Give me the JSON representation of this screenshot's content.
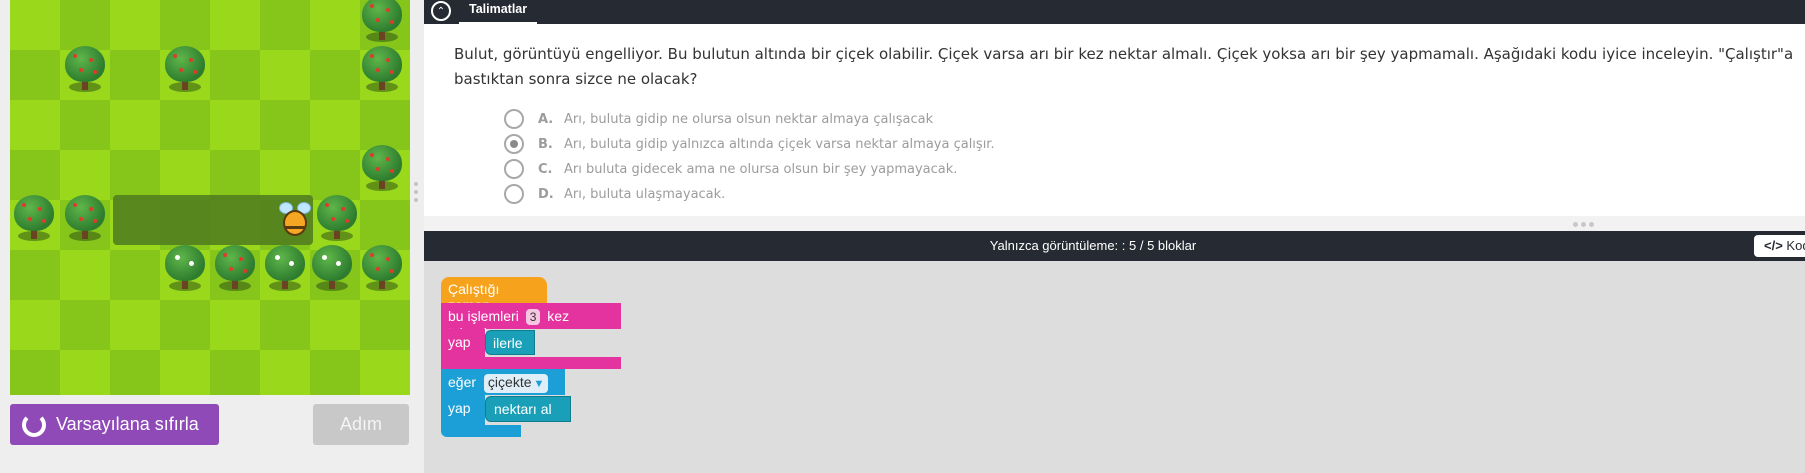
{
  "left": {
    "reset_label": "Varsayılana sıfırla",
    "step_label": "Adım"
  },
  "instructions": {
    "tab_label": "Talimatlar",
    "question": "Bulut, görüntüyü engelliyor. Bu bulutun altında bir çiçek olabilir. Çiçek varsa arı bir kez nektar almalı. Çiçek yoksa arı bir şey yapmamalı. Aşağıdaki kodu iyice inceleyin. \"Çalıştır\"a bastıktan sonra sizce ne olacak?",
    "options": [
      {
        "letter": "A.",
        "text": "Arı, buluta gidip ne olursa olsun nektar almaya çalışacak",
        "selected": false
      },
      {
        "letter": "B.",
        "text": "Arı, buluta gidip yalnızca altında çiçek varsa nektar almaya çalışır.",
        "selected": true
      },
      {
        "letter": "C.",
        "text": "Arı buluta gidecek ama ne olursa olsun bir şey yapmayacak.",
        "selected": false
      },
      {
        "letter": "D.",
        "text": "Arı, buluta ulaşmayacak.",
        "selected": false
      }
    ]
  },
  "workspace": {
    "title": "Yalnızca görüntüleme: : 5 / 5 bloklar",
    "code_button": "Kod",
    "blocks": {
      "when_run": "Çalıştığı zaman",
      "repeat_prefix": "bu işlemleri",
      "repeat_count": "3",
      "repeat_suffix": "kez tekrarla",
      "do_label": "yap",
      "forward": "ilerle",
      "if_label": "eğer",
      "condition": "çiçekte",
      "do_label_2": "yap",
      "get_nectar": "nektarı al"
    }
  },
  "colors": {
    "header_bg": "#262b33",
    "reset_bg": "#8f4ab8",
    "block_event": "#f7a21d",
    "block_loop": "#e4329f",
    "block_logic": "#1c9fd6",
    "block_action": "#19a0b8"
  },
  "icons": {
    "collapse": "chevron-up-circle-icon",
    "reset": "reset-icon",
    "code": "code-icon"
  }
}
